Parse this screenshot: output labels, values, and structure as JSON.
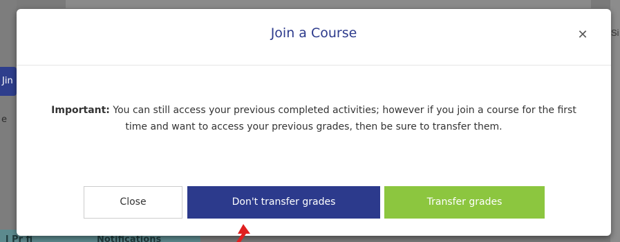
{
  "background": {
    "join_fragment": "Jin",
    "left_fragment": "e",
    "right_fragment": "Si",
    "tabs": [
      "l Pr fi",
      "Notifications"
    ]
  },
  "modal": {
    "title": "Join a Course",
    "close_icon": "close-icon",
    "body": {
      "important_label": "Important:",
      "message": " You can still access your previous completed activities; however if you join a course for the first time and want to access your previous grades, then be sure to transfer them."
    },
    "buttons": {
      "close_label": "Close",
      "dont_transfer_label": "Don't transfer grades",
      "transfer_label": "Transfer grades"
    }
  },
  "colors": {
    "primary": "#2c3a8c",
    "success": "#8cc63f",
    "annotation_arrow": "#e02020"
  }
}
